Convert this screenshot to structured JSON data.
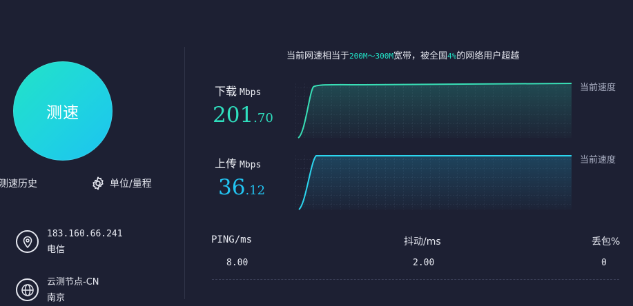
{
  "left": {
    "speed_test_button": "测速",
    "history_label": "测速历史",
    "unit_label": "单位/量程",
    "ip": "183.160.66.241",
    "isp": "电信",
    "node": "云测节点-CN",
    "city": "南京"
  },
  "summary": {
    "prefix": "当前网速相当于",
    "band": "200M～300M",
    "middle": "宽带，被全国",
    "percent": "4%",
    "suffix": "的网络用户超越"
  },
  "download": {
    "label": "下载",
    "unit": "Mbps",
    "int_part": "201",
    "dec_part": ".70",
    "current_label": "当前速度"
  },
  "upload": {
    "label": "上传",
    "unit": "Mbps",
    "int_part": "36",
    "dec_part": ".12",
    "current_label": "当前速度"
  },
  "stats": {
    "ping_label": "PING/ms",
    "ping_value": "8.00",
    "jitter_label": "抖动/ms",
    "jitter_value": "2.00",
    "loss_label": "丢包%",
    "loss_value": "0"
  },
  "colors": {
    "download_line": "#39dfb6",
    "upload_line": "#2cd6ef",
    "background": "#1d2033"
  }
}
